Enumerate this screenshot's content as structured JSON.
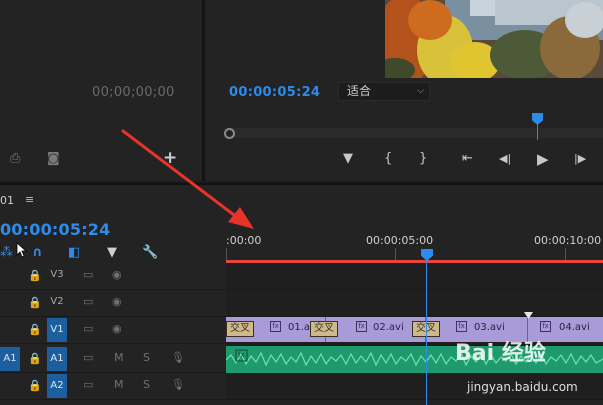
{
  "source": {
    "timecode": "00;00;00;00",
    "add_label": "+"
  },
  "program": {
    "timecode": "00:00:05:24",
    "zoom": "适合"
  },
  "transport": {
    "marker": "▼",
    "in": "{",
    "out": "}",
    "goto_in": "⇤",
    "step_back": "◀|",
    "play": "▶",
    "step_fwd": "|▶"
  },
  "timeline": {
    "sequence_name": "01",
    "menu": "≡",
    "timecode": "00:00:05:24",
    "ruler": [
      ":00:00",
      "00:00:05:00",
      "00:00:10:00"
    ],
    "tracks_video": [
      {
        "label": "V3",
        "active": false
      },
      {
        "label": "V2",
        "active": false
      },
      {
        "label": "V1",
        "active": true
      }
    ],
    "tracks_audio": [
      {
        "src": "A1",
        "label": "A1",
        "m": "M",
        "s": "S"
      },
      {
        "src": "",
        "label": "A2",
        "m": "M",
        "s": "S"
      }
    ],
    "clips": [
      {
        "name": "01.a"
      },
      {
        "name": "02.avi"
      },
      {
        "name": "03.avi"
      },
      {
        "name": "04.avi"
      }
    ],
    "transitions": [
      "交叉",
      "交叉",
      "交叉"
    ],
    "fx_label": "fx"
  },
  "watermark": {
    "logo": "Bai 经验",
    "url": "jingyan.baidu.com"
  },
  "colors": {
    "accent_blue": "#2d8ceb",
    "work_bar_red": "#e8463b",
    "video_clip": "#a99bd8",
    "audio_clip": "#1f9a6f",
    "arrow_red": "#e8332a"
  }
}
